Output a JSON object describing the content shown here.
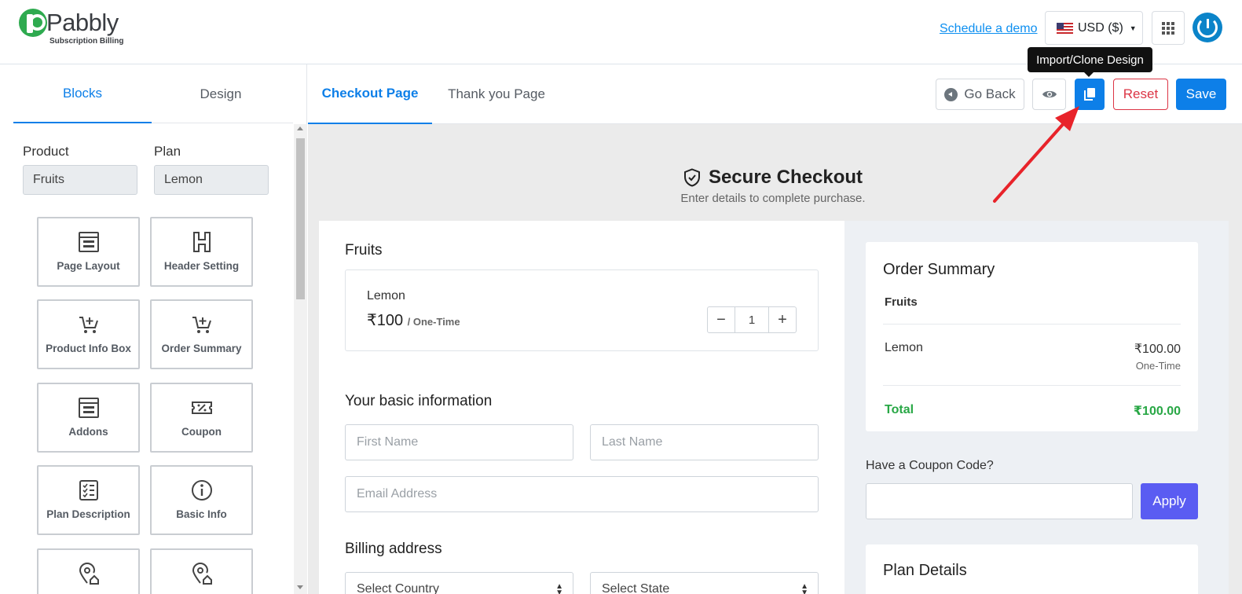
{
  "header": {
    "logo_text": "Pabbly",
    "logo_sub": "Subscription Billing",
    "schedule_demo": "Schedule a demo",
    "currency": "USD ($)",
    "tooltip": "Import/Clone Design"
  },
  "sidebar": {
    "tabs": [
      "Blocks",
      "Design"
    ],
    "product_label": "Product",
    "product_value": "Fruits",
    "plan_label": "Plan",
    "plan_value": "Lemon",
    "blocks": [
      {
        "label": "Page Layout",
        "icon": "layout-icon"
      },
      {
        "label": "Header Setting",
        "icon": "header-h-icon"
      },
      {
        "label": "Product Info Box",
        "icon": "cart-plus-icon"
      },
      {
        "label": "Order Summary",
        "icon": "cart-plus-icon"
      },
      {
        "label": "Addons",
        "icon": "layout-icon"
      },
      {
        "label": "Coupon",
        "icon": "coupon-icon"
      },
      {
        "label": "Plan Description",
        "icon": "checklist-icon"
      },
      {
        "label": "Basic Info",
        "icon": "info-icon"
      }
    ]
  },
  "toolbar": {
    "tabs": [
      "Checkout Page",
      "Thank you Page"
    ],
    "go_back": "Go Back",
    "reset": "Reset",
    "save": "Save"
  },
  "checkout": {
    "title": "Secure Checkout",
    "subtitle": "Enter details to complete purchase.",
    "product_heading": "Fruits",
    "plan_name": "Lemon",
    "price": "₹100",
    "price_freq": "/ One-Time",
    "quantity": "1",
    "basic_info_heading": "Your basic information",
    "first_name_placeholder": "First Name",
    "last_name_placeholder": "Last Name",
    "email_placeholder": "Email Address",
    "billing_heading": "Billing address",
    "country_placeholder": "Select Country",
    "state_placeholder": "Select State"
  },
  "order_summary": {
    "title": "Order Summary",
    "product": "Fruits",
    "item": "Lemon",
    "amount": "₹100.00",
    "frequency": "One-Time",
    "total_label": "Total",
    "total_amount": "₹100.00",
    "coupon_label": "Have a Coupon Code?",
    "apply": "Apply",
    "plan_details": "Plan Details"
  },
  "colors": {
    "primary": "#0d7fe8",
    "danger": "#dc3545",
    "success": "#28a745",
    "apply": "#5a5cf2",
    "annotation_arrow": "#e8232a"
  }
}
